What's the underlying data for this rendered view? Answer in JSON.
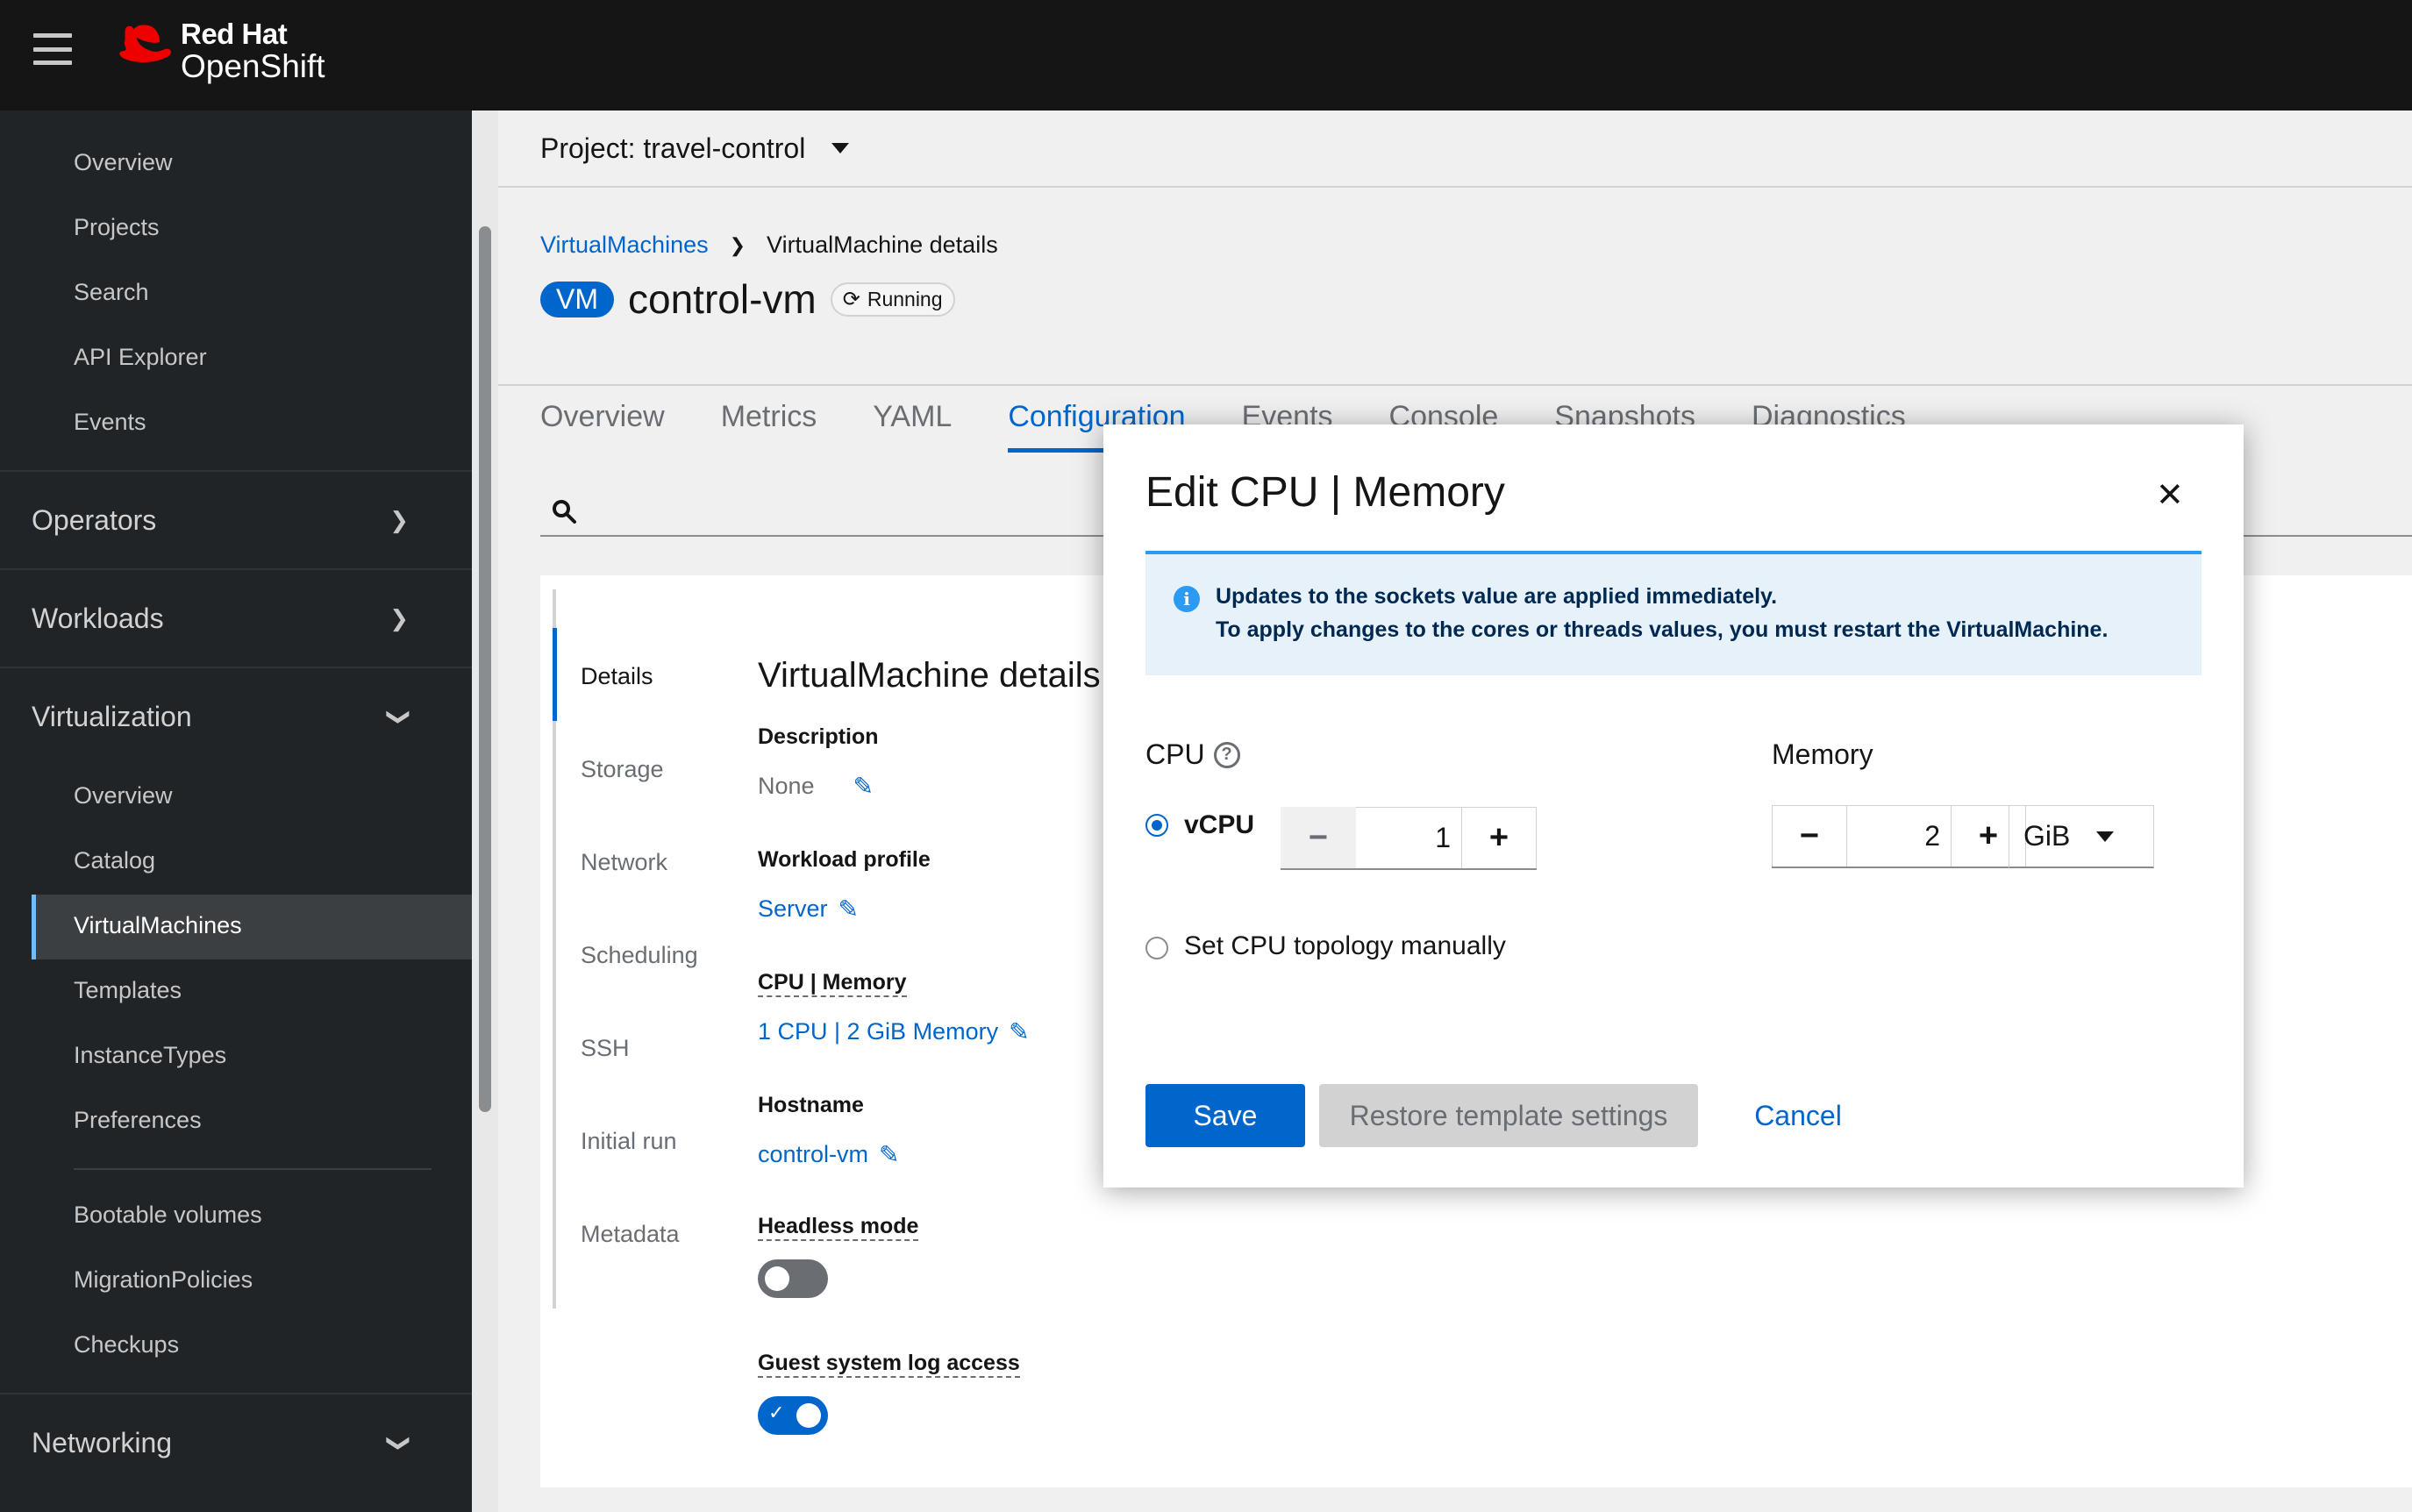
{
  "masthead": {
    "brand": "Red Hat",
    "product": "OpenShift"
  },
  "sidebar": {
    "top_items": [
      "Overview",
      "Projects",
      "Search",
      "API Explorer",
      "Events"
    ],
    "sections": {
      "operators": "Operators",
      "workloads": "Workloads",
      "virtualization": "Virtualization",
      "networking": "Networking"
    },
    "virtualization_items": [
      "Overview",
      "Catalog",
      "VirtualMachines",
      "Templates",
      "InstanceTypes",
      "Preferences"
    ],
    "virtualization_items_2": [
      "Bootable volumes",
      "MigrationPolicies",
      "Checkups"
    ],
    "active_item": "VirtualMachines"
  },
  "project_bar": {
    "label": "Project: travel-control"
  },
  "breadcrumb": {
    "parent": "VirtualMachines",
    "current": "VirtualMachine details"
  },
  "header": {
    "badge": "VM",
    "title": "control-vm",
    "status": "Running"
  },
  "tabs": [
    "Overview",
    "Metrics",
    "YAML",
    "Configuration",
    "Events",
    "Console",
    "Snapshots",
    "Diagnostics"
  ],
  "active_tab": "Configuration",
  "config": {
    "vtabs": [
      "Details",
      "Storage",
      "Network",
      "Scheduling",
      "SSH",
      "Initial run",
      "Metadata"
    ],
    "section_title": "VirtualMachine details",
    "description_label": "Description",
    "description_value": "None",
    "workload_label": "Workload profile",
    "workload_value": "Server",
    "cpu_mem_label": "CPU | Memory",
    "cpu_mem_value": "1 CPU | 2 GiB Memory",
    "hostname_label": "Hostname",
    "hostname_value": "control-vm",
    "headless_label": "Headless mode",
    "headless_on": false,
    "guest_log_label": "Guest system log access",
    "guest_log_on": true
  },
  "modal": {
    "title": "Edit CPU | Memory",
    "alert_line1": "Updates to the sockets value are applied immediately.",
    "alert_line2": "To apply changes to the cores or threads values, you must restart the VirtualMachine.",
    "cpu_label": "CPU",
    "memory_label": "Memory",
    "vcpu_label": "vCPU",
    "vcpu_value": "1",
    "topology_label": "Set CPU topology manually",
    "memory_value": "2",
    "memory_unit": "GiB",
    "save": "Save",
    "restore": "Restore template settings",
    "cancel": "Cancel"
  },
  "colors": {
    "accent": "#0066cc",
    "masthead": "#151515",
    "sidebar": "#212427",
    "alert_bg": "#e7f1fa",
    "info": "#2b9af3"
  }
}
